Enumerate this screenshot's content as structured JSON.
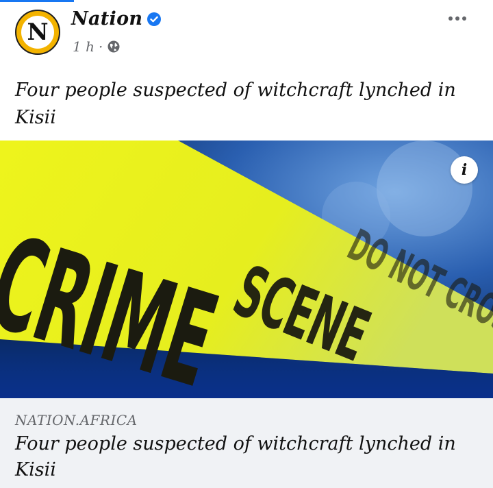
{
  "post": {
    "page_name": "Nation",
    "avatar_letter": "N",
    "verified_icon": "verified-badge-icon",
    "time": "1 h",
    "separator": "·",
    "audience_icon": "globe-icon",
    "more_icon": "more-horizontal-icon",
    "caption": "Four people suspected of witchcraft lynched in Kisii"
  },
  "link_preview": {
    "image_tape_text": "CRIME SCENE DO NOT CROSS",
    "info_label": "i",
    "domain": "NATION.AFRICA",
    "title": "Four people suspected of witchcraft lynched in Kisii"
  },
  "colors": {
    "accent": "#1877f2",
    "avatar_bg": "#f3b300",
    "tape": "#e9f01a",
    "footer_bg": "#f0f2f5"
  }
}
